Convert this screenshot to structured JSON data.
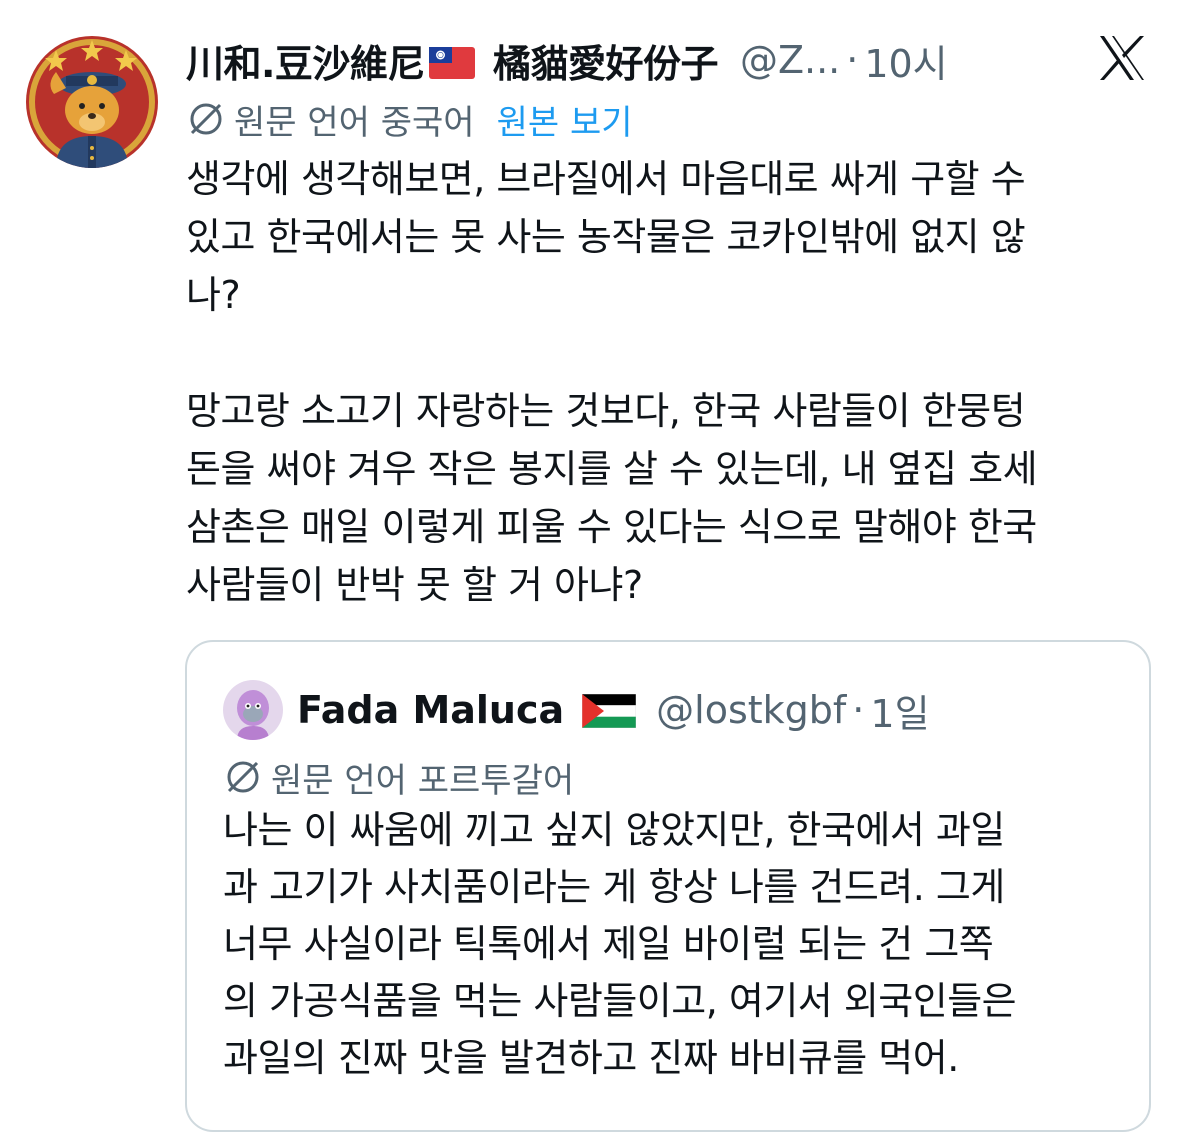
{
  "post": {
    "author_name": "川和.豆沙維尼",
    "author_flag": "taiwan-flag-icon",
    "author_name_suffix": "橘貓愛好份子",
    "handle": "@Z...",
    "separator": "·",
    "time": "10시",
    "translation_label": "원문 언어 중국어",
    "show_original": "원본 보기",
    "text": "생각에 생각해보면, 브라질에서 마음대로 싸게 구할 수\n있고 한국에서는 못 사는 농작물은 코카인밖에 없지 않\n나?\n\n망고랑 소고기 자랑하는 것보다, 한국 사람들이 한뭉텅\n돈을 써야 겨우 작은 봉지를 살 수 있는데, 내 옆집 호세\n삼촌은 매일 이렇게 피울 수 있다는 식으로 말해야 한국\n사람들이 반박 못 할 거 아냐?"
  },
  "quoted": {
    "author_name": "Fada Maluca",
    "author_flag": "palestine-flag-icon",
    "handle": "@lostkgbf",
    "separator": "·",
    "time": "1일",
    "translation_label": "원문 언어 포르투갈어",
    "text": "나는 이 싸움에 끼고 싶지 않았지만, 한국에서 과일\n과 고기가 사치품이라는 게 항상 나를 건드려. 그게\n너무 사실이라 틱톡에서 제일 바이럴 되는 건 그쪽\n의 가공식품을 먹는 사람들이고, 여기서 외국인들은\n과일의 진짜 맛을 발견하고 진짜 바비큐를 먹어."
  },
  "icons": {
    "close": "x-logo-icon",
    "translate": "globe-translate-icon"
  },
  "colors": {
    "text": "#0f1419",
    "secondary": "#536471",
    "link": "#1d9bf0",
    "border": "#cfd9de"
  }
}
